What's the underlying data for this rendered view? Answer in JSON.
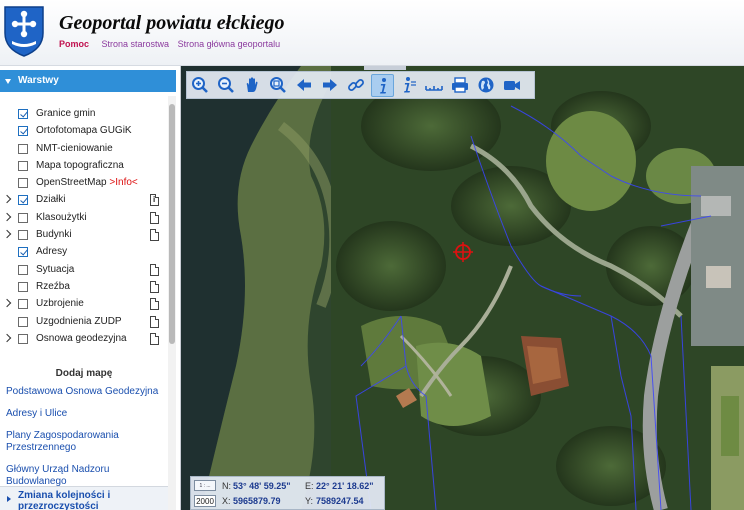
{
  "header": {
    "title": "Geoportal powiatu ełckiego",
    "help_label": "Pomoc",
    "links": [
      "Strona starostwa",
      "Strona główna geoportalu"
    ]
  },
  "sidebar": {
    "panel_title": "Warstwy",
    "layers": [
      {
        "label": "Granice gmin",
        "checked": true,
        "expandable": false,
        "doc": ""
      },
      {
        "label": "Ortofotomapa GUGiK",
        "checked": true,
        "expandable": false,
        "doc": ""
      },
      {
        "label": "NMT-cieniowanie",
        "checked": false,
        "expandable": false,
        "doc": ""
      },
      {
        "label": "Mapa topograficzna",
        "checked": false,
        "expandable": false,
        "doc": ""
      },
      {
        "label": "OpenStreetMap",
        "info": ">Info<",
        "checked": false,
        "expandable": false,
        "doc": ""
      },
      {
        "label": "Działki",
        "checked": true,
        "expandable": true,
        "doc": "info"
      },
      {
        "label": "Klasoużytki",
        "checked": false,
        "expandable": true,
        "doc": "plain"
      },
      {
        "label": "Budynki",
        "checked": false,
        "expandable": true,
        "doc": "plain"
      },
      {
        "label": "Adresy",
        "checked": true,
        "expandable": false,
        "doc": ""
      },
      {
        "label": "Sytuacja",
        "checked": false,
        "expandable": false,
        "doc": "plain"
      },
      {
        "label": "Rzeźba",
        "checked": false,
        "expandable": false,
        "doc": "plain"
      },
      {
        "label": "Uzbrojenie",
        "checked": false,
        "expandable": true,
        "doc": "plain"
      },
      {
        "label": "Uzgodnienia ZUDP",
        "checked": false,
        "expandable": false,
        "doc": "plain"
      },
      {
        "label": "Osnowa geodezyjna",
        "checked": false,
        "expandable": true,
        "doc": "plain"
      }
    ],
    "add_map_title": "Dodaj mapę",
    "map_links": [
      "Podstawowa Osnowa Geodezyjna",
      "Adresy i Ulice",
      "Plany Zagospodarowania Przestrzennego",
      "Główny Urząd Nadzoru Budowlanego"
    ],
    "order_label": "Zmiana kolejności i przezroczystości"
  },
  "toolbar": {
    "tools": [
      "zoom-in-icon",
      "zoom-out-icon",
      "pan-hand-icon",
      "zoom-window-icon",
      "back-arrow-icon",
      "forward-arrow-icon",
      "link-icon",
      "info-icon",
      "identify-icon",
      "measure-ruler-icon",
      "print-icon",
      "globe-icon",
      "camera-icon"
    ],
    "active_tool": "info-icon"
  },
  "coords": {
    "scale_text": "1 : ...",
    "zoom_value": "2000",
    "n_label": "N:",
    "n_value": "53° 48' 59.25\"",
    "e_label": "E:",
    "e_value": "22° 21' 18.62\"",
    "x_label": "X:",
    "x_value": "5965879.79",
    "y_label": "Y:",
    "y_value": "7589247.54"
  },
  "colors": {
    "header_accent": "#2f8fd8",
    "link": "#1a4fae",
    "help": "#c0114f",
    "info": "#dd1111"
  }
}
